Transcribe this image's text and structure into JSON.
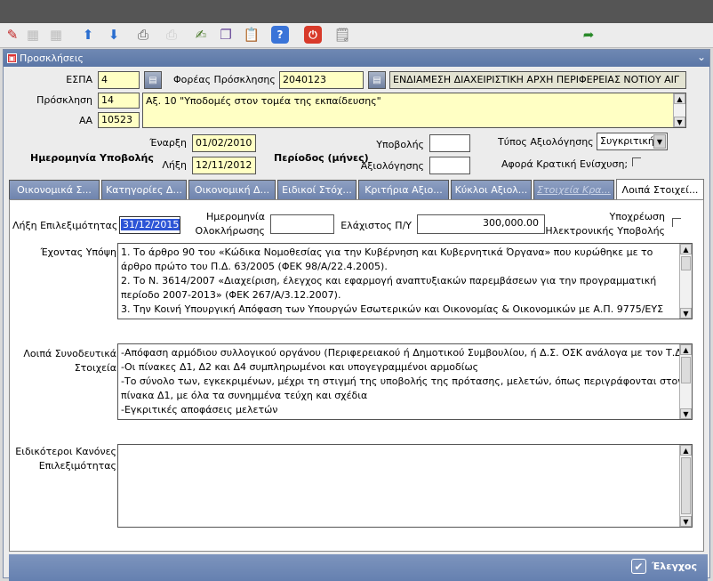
{
  "toolbar": {
    "buttons": [
      {
        "name": "pencil-icon",
        "glyph": "✎",
        "color": "#c02020"
      },
      {
        "name": "grid-icon",
        "glyph": "▦",
        "color": "#777"
      },
      {
        "name": "grid-delete-icon",
        "glyph": "▦",
        "color": "#777"
      },
      {
        "name": "arrow-up-icon",
        "glyph": "⬆",
        "color": "#2a6ed0"
      },
      {
        "name": "arrow-down-icon",
        "glyph": "⬇",
        "color": "#2a6ed0"
      },
      {
        "name": "printer-icon",
        "glyph": "⎙",
        "color": "#555"
      },
      {
        "name": "print-preview-icon",
        "glyph": "⎙",
        "color": "#999"
      },
      {
        "name": "edit-document-icon",
        "glyph": "✍",
        "color": "#4a7a2a"
      },
      {
        "name": "copy-document-icon",
        "glyph": "❐",
        "color": "#6a4a9a"
      },
      {
        "name": "paste-icon",
        "glyph": "📋",
        "color": "#b08020"
      },
      {
        "name": "help-icon",
        "glyph": "?",
        "color": "#fff"
      },
      {
        "name": "exit-icon",
        "glyph": "⏻",
        "color": "#fff"
      },
      {
        "name": "notes-icon",
        "glyph": "🗒",
        "color": "#777"
      },
      {
        "name": "return-arrow-icon",
        "glyph": "➦",
        "color": "#2a8a2a"
      }
    ]
  },
  "window": {
    "title": "Προσκλήσεις"
  },
  "header": {
    "espa_label": "ΕΣΠΑ",
    "espa_value": "4",
    "foreas_label": "Φορέας Πρόσκλησης",
    "foreas_code": "2040123",
    "foreas_name": "ΕΝΔΙΑΜΕΣΗ ΔΙΑΧΕΙΡΙΣΤΙΚΗ ΑΡΧΗ ΠΕΡΙΦΕΡΕΙΑΣ ΝΟΤΙΟΥ ΑΙΓ",
    "prosklisi_label": "Πρόσκληση",
    "prosklisi_value": "14",
    "aa_label": "ΑΑ",
    "aa_value": "10523",
    "prosklisi_title": "Αξ. 10 \"Υποδομές στον τομέα της εκπαίδευσης\"",
    "submission_date_label": "Ημερομηνία Υποβολής",
    "start_label": "Έναρξη",
    "start_value": "01/02/2010",
    "end_label": "Λήξη",
    "end_value": "12/11/2012",
    "period_label": "Περίοδος (μήνες)",
    "submission_label": "Υποβολής",
    "evaluation_label": "Αξιολόγησης",
    "eval_type_label": "Τύπος Αξιολόγησης",
    "eval_type_value": "Συγκριτική",
    "state_aid_label": "Αφορά Κρατική  Ενίσχυση;"
  },
  "tabs": [
    {
      "label": "Οικονομικά Σ...",
      "state": "normal"
    },
    {
      "label": "Κατηγορίες Δ...",
      "state": "normal"
    },
    {
      "label": "Οικονομική Δ...",
      "state": "normal"
    },
    {
      "label": "Ειδικοί Στόχ...",
      "state": "normal"
    },
    {
      "label": "Κριτήρια Αξιο...",
      "state": "normal"
    },
    {
      "label": "Κύκλοι Αξιολ...",
      "state": "normal"
    },
    {
      "label": "Στοιχεία Κρα...",
      "state": "dim"
    },
    {
      "label": "Λοιπά Στοιχεί...",
      "state": "active"
    }
  ],
  "panel": {
    "eligibility_end_label": "Λήξη Επιλεξιμότητας",
    "eligibility_end_value": "31/12/2015",
    "completion_date_label_1": "Ημερομηνία",
    "completion_date_label_2": "Ολοκλήρωσης",
    "min_budget_label": "Ελάχιστος Π/Υ",
    "min_budget_value": "300,000.00",
    "electronic_label_1": "Υποχρέωση",
    "electronic_label_2": "Ηλεκτρονικής Υποβολής",
    "considering_label": "Έχοντας Υπόψη",
    "considering_lines": [
      "1.     Το άρθρο 90 του «Κώδικα Νομοθεσίας για την Κυβέρνηση και Κυβερνητικά Όργανα» που κυρώθηκε με το",
      "άρθρο πρώτο του Π.Δ. 63/2005 (ΦΕΚ 98/Α/22.4.2005).",
      "2.     Το Ν. 3614/2007 «Διαχείριση, έλεγχος και εφαρμογή αναπτυξιακών παρεμβάσεων για την προγραμματική",
      "περίοδο 2007-2013» (ΦΕΚ 267/Α/3.12.2007).",
      "3.     Την Κοινή Υπουργική Απόφαση των Υπουργών Εσωτερικών και Οικονομίας & Οικονομικών με Α.Π. 9775/ΕΥΣ"
    ],
    "other_docs_label_1": "Λοιπά Συνοδευτικά",
    "other_docs_label_2": "Στοιχεία",
    "other_docs_lines": [
      "-Απόφαση αρμόδιου συλλογικού οργάνου (Περιφερειακού ή Δημοτικού Συμβουλίου, ή Δ.Σ. ΟΣΚ ανάλογα με τον Τ.Δ.)",
      "-Οι πίνακες Δ1, Δ2 και Δ4 συμπληρωμένοι και υπογεγραμμένοι αρμοδίως",
      "-Το σύνολο των, εγκεκριμένων, μέχρι τη στιγμή της υποβολής της πρότασης, μελετών, όπως περιγράφονται στον",
      "πίνακα Δ1, με όλα τα συνημμένα τεύχη και σχέδια",
      "-Εγκριτικές αποφάσεις μελετών"
    ],
    "special_rules_label_1": "Ειδικότεροι Κανόνες",
    "special_rules_label_2": "Επιλεξιμότητας"
  },
  "footer": {
    "check_label": "Έλεγχος"
  }
}
